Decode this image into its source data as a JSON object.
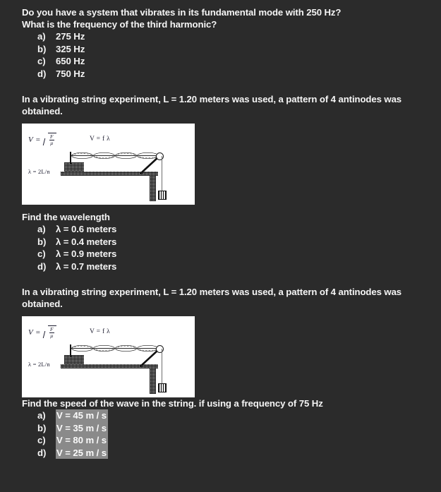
{
  "theme": {
    "background": "#2b2b2b",
    "text_color": "#f5f5f5",
    "selection_highlight": "#8a8a8a",
    "figure_background": "#ffffff"
  },
  "questions": [
    {
      "id": "q1",
      "prompt_lines": [
        "Do you have a system that vibrates in its fundamental mode with 250 Hz?",
        "What is the frequency of the third harmonic?"
      ],
      "options": [
        {
          "marker": "a)",
          "text": "275 Hz",
          "highlighted": false
        },
        {
          "marker": "b)",
          "text": "325 Hz",
          "highlighted": false
        },
        {
          "marker": "c)",
          "text": "650 Hz",
          "highlighted": false
        },
        {
          "marker": "d)",
          "text": "750 Hz",
          "highlighted": false
        }
      ]
    },
    {
      "id": "q2",
      "prompt_lines": [
        "In a vibrating string experiment, L = 1.20 meters was used, a pattern of 4 antinodes was",
        "obtained."
      ],
      "figure": {
        "name": "vibrating-string-apparatus",
        "formula_v_label": "V",
        "formula_v_equals": "=",
        "formula_v_numerator": "F",
        "formula_v_denominator": "μ",
        "formula_fl": "V = f λ",
        "formula_lambda": "λ = 2L/n",
        "antinodes": 4
      },
      "question_line": "Find the wavelength",
      "options": [
        {
          "marker": "a)",
          "text": "λ = 0.6 meters",
          "highlighted": false
        },
        {
          "marker": "b)",
          "text": "λ = 0.4 meters",
          "highlighted": false
        },
        {
          "marker": "c)",
          "text": "λ = 0.9 meters",
          "highlighted": false
        },
        {
          "marker": "d)",
          "text": "λ = 0.7 meters",
          "highlighted": false
        }
      ]
    },
    {
      "id": "q3",
      "prompt_lines": [
        "In a vibrating string experiment, L = 1.20 meters was used, a pattern of 4 antinodes was",
        "obtained."
      ],
      "figure": {
        "name": "vibrating-string-apparatus",
        "formula_v_label": "V",
        "formula_v_equals": "=",
        "formula_v_numerator": "F",
        "formula_v_denominator": "μ",
        "formula_fl": "V = f λ",
        "formula_lambda": "λ = 2L/n",
        "antinodes": 4
      },
      "question_line": "Find the speed of the wave in the string. if using a frequency of 75 Hz",
      "options": [
        {
          "marker": "a)",
          "text": "V = 45 m / s",
          "highlighted": true
        },
        {
          "marker": "b)",
          "text": "V = 35 m / s",
          "highlighted": true
        },
        {
          "marker": "c)",
          "text": "V = 80 m / s",
          "highlighted": true
        },
        {
          "marker": "d)",
          "text": "V = 25 m / s",
          "highlighted": true
        }
      ]
    }
  ]
}
